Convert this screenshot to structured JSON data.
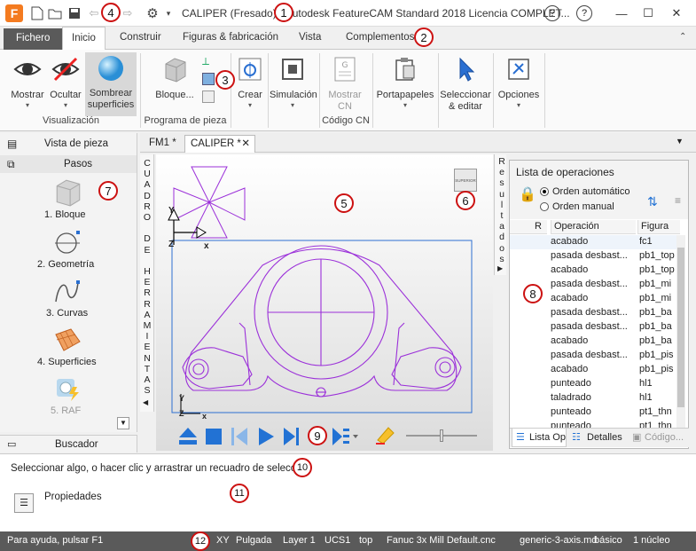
{
  "title_bar": {
    "title": "CALIPER (Fresado) - Autodesk FeatureCAM Standard 2018 Licencia COMPLET...",
    "app_icon": "F",
    "help_symbol": "?"
  },
  "ribbon_tabs": [
    {
      "label": "Fichero"
    },
    {
      "label": "Inicio"
    },
    {
      "label": "Construir"
    },
    {
      "label": "Figuras & fabricación"
    },
    {
      "label": "Vista"
    },
    {
      "label": "Complementos"
    }
  ],
  "ribbon": {
    "mostrar": "Mostrar",
    "ocultar": "Ocultar",
    "sombrear_1": "Sombrear",
    "sombrear_2": "superficies",
    "grp_visualizacion": "Visualización",
    "bloque": "Bloque...",
    "grp_programa": "Programa de pieza",
    "crear": "Crear",
    "simulacion": "Simulación",
    "mostrar_cn_1": "Mostrar",
    "mostrar_cn_2": "CN",
    "grp_codigo": "Código CN",
    "portapapeles": "Portapapeles",
    "seleccionar_1": "Seleccionar",
    "seleccionar_2": "& editar",
    "opciones": "Opciones"
  },
  "left_panel": {
    "vista_pieza": "Vista de pieza",
    "pasos": "Pasos",
    "steps": [
      {
        "label": "1.  Bloque"
      },
      {
        "label": "2.  Geometría"
      },
      {
        "label": "3.  Curvas"
      },
      {
        "label": "4.  Superficies"
      },
      {
        "label": "5.  RAF"
      }
    ],
    "buscador": "Buscador",
    "propiedades": "Propiedades"
  },
  "doc_tabs": [
    {
      "label": "FM1 *"
    },
    {
      "label": "CALIPER *"
    }
  ],
  "tool_strip": {
    "letters": [
      "C",
      "U",
      "A",
      "D",
      "R",
      "O",
      "",
      "D",
      "E",
      "",
      "H",
      "E",
      "R",
      "R",
      "A",
      "M",
      "I",
      "E",
      "N",
      "T",
      "A",
      "S"
    ]
  },
  "results_strip": {
    "letters": [
      "R",
      "e",
      "s",
      "u",
      "l",
      "t",
      "a",
      "d",
      "o",
      "s"
    ]
  },
  "viewport": {
    "view_cube_label": "SUPERIOR",
    "axis_x": "X",
    "axis_y": "Y",
    "axis_z": "Z"
  },
  "ops_panel": {
    "title": "Lista de operaciones",
    "orden_auto": "Orden automático",
    "orden_manual": "Orden manual",
    "col_r": "R",
    "col_operacion": "Operación",
    "col_figura": "Figura",
    "rows": [
      {
        "op": "acabado",
        "fig": "fc1"
      },
      {
        "op": "pasada desbast...",
        "fig": "pb1_top"
      },
      {
        "op": "acabado",
        "fig": "pb1_top"
      },
      {
        "op": "pasada desbast...",
        "fig": "pb1_mi"
      },
      {
        "op": "acabado",
        "fig": "pb1_mi"
      },
      {
        "op": "pasada desbast...",
        "fig": "pb1_ba"
      },
      {
        "op": "pasada desbast...",
        "fig": "pb1_ba"
      },
      {
        "op": "acabado",
        "fig": "pb1_ba"
      },
      {
        "op": "pasada desbast...",
        "fig": "pb1_pis"
      },
      {
        "op": "acabado",
        "fig": "pb1_pis"
      },
      {
        "op": "punteado",
        "fig": "hl1"
      },
      {
        "op": "taladrado",
        "fig": "hl1"
      },
      {
        "op": "punteado",
        "fig": "pt1_thn"
      },
      {
        "op": "punteado",
        "fig": "pt1_thn"
      }
    ],
    "tab_lista": "Lista Op",
    "tab_detalles": "Detalles",
    "tab_codigo": "Código..."
  },
  "command_line": {
    "prompt": "Seleccionar algo, o hacer clic y arrastrar un recuadro de selección"
  },
  "status_bar": {
    "help": "Para ayuda, pulsar F1",
    "plane": "XY",
    "units": "Pulgada",
    "layer": "Layer 1",
    "ucs": "UCS1",
    "view": "top",
    "post": "Fanuc 3x Mill Default.cnc",
    "machine": "generic-3-axis.md",
    "mode": "básico",
    "cores": "1 núcleo"
  },
  "callouts": [
    "1",
    "2",
    "3",
    "4",
    "5",
    "6",
    "7",
    "8",
    "9",
    "10",
    "11",
    "12"
  ],
  "colors": {
    "accent_red": "#cc1111",
    "part_geometry": "#9b30d9",
    "stock_outline": "#2d6fd1",
    "status_bg": "#5a5a5a"
  }
}
